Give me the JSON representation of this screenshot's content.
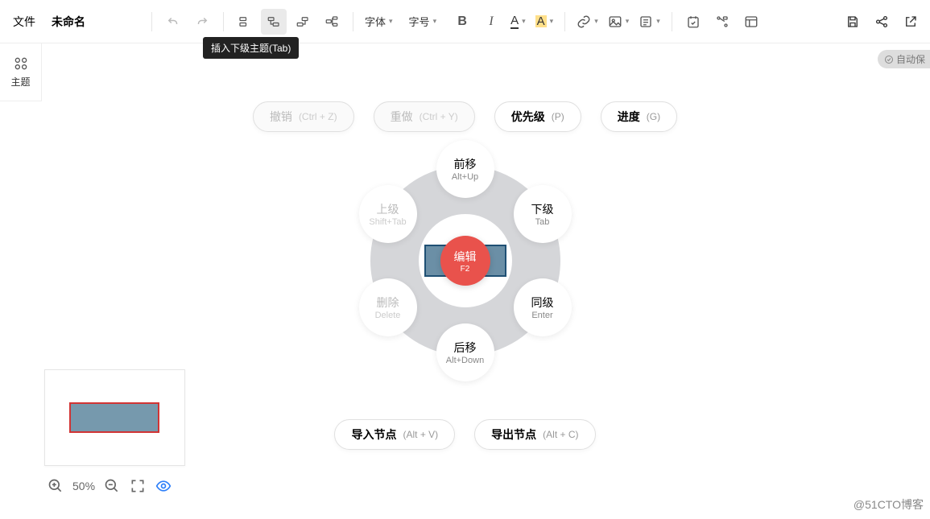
{
  "menu": {
    "file": "文件",
    "title": "未命名"
  },
  "tooltip": "插入下级主题(Tab)",
  "theme_label": "主题",
  "autosave": "自动保",
  "toolbar": {
    "font": "字体",
    "fontsize": "字号"
  },
  "pills_top": [
    {
      "label": "撤销",
      "shortcut": "(Ctrl + Z)",
      "disabled": true
    },
    {
      "label": "重做",
      "shortcut": "(Ctrl + Y)",
      "disabled": true
    },
    {
      "label": "优先级",
      "shortcut": "(P)",
      "disabled": false
    },
    {
      "label": "进度",
      "shortcut": "(G)",
      "disabled": false
    }
  ],
  "radial": {
    "center": {
      "label": "编辑",
      "key": "F2"
    },
    "top": {
      "label": "前移",
      "key": "Alt+Up",
      "disabled": false
    },
    "bottom": {
      "label": "后移",
      "key": "Alt+Down",
      "disabled": false
    },
    "tl": {
      "label": "上级",
      "key": "Shift+Tab",
      "disabled": true
    },
    "tr": {
      "label": "下级",
      "key": "Tab",
      "disabled": false
    },
    "bl": {
      "label": "删除",
      "key": "Delete",
      "disabled": true
    },
    "br": {
      "label": "同级",
      "key": "Enter",
      "disabled": false
    }
  },
  "pills_bottom": [
    {
      "label": "导入节点",
      "shortcut": "(Alt + V)"
    },
    {
      "label": "导出节点",
      "shortcut": "(Alt + C)"
    }
  ],
  "zoom": "50%",
  "watermark": "@51CTO博客"
}
